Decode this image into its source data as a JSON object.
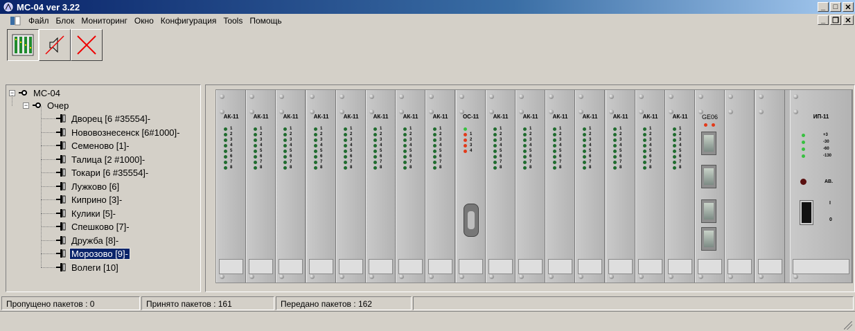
{
  "window": {
    "title": "МС-04  ver 3.22"
  },
  "menu": {
    "items": [
      "Файл",
      "Блок",
      "Мониторинг",
      "Окно",
      "Конфигурация",
      "Tools",
      "Помощь"
    ]
  },
  "toolbar": {
    "buttons": [
      {
        "icon": "rack-view-icon"
      },
      {
        "icon": "sound-off-icon"
      },
      {
        "icon": "close-x-icon"
      }
    ]
  },
  "tree": {
    "root": "МС-04",
    "group": "Очер",
    "selected_index": 10,
    "items": [
      "Дворец [6 #35554]-",
      "Нововознесенск [6#1000]-",
      "Семеново [1]-",
      "Талица [2 #1000]-",
      "Токари [6 #35554]-",
      "Лужково [6]",
      "Киприно [3]-",
      "Кулики [5]-",
      "Спешково [7]-",
      "Дружба [8]-",
      "Морозово [9]-",
      "Волеги [10]"
    ]
  },
  "rack": {
    "cards": [
      {
        "name": "АК-11",
        "kind": "ak"
      },
      {
        "name": "АК-11",
        "kind": "ak"
      },
      {
        "name": "АК-11",
        "kind": "ak"
      },
      {
        "name": "АК-11",
        "kind": "ak"
      },
      {
        "name": "АК-11",
        "kind": "ak"
      },
      {
        "name": "АК-11",
        "kind": "ak"
      },
      {
        "name": "АК-11",
        "kind": "ak"
      },
      {
        "name": "АК-11",
        "kind": "ak"
      },
      {
        "name": "ОС-11",
        "kind": "oc"
      },
      {
        "name": "АК-11",
        "kind": "ak"
      },
      {
        "name": "АК-11",
        "kind": "ak"
      },
      {
        "name": "АК-11",
        "kind": "ak"
      },
      {
        "name": "АК-11",
        "kind": "ak"
      },
      {
        "name": "АК-11",
        "kind": "ak"
      },
      {
        "name": "АК-11",
        "kind": "ak"
      },
      {
        "name": "АК-11",
        "kind": "ak"
      },
      {
        "name": "GE06",
        "kind": "ge"
      },
      {
        "name": "",
        "kind": "blank"
      },
      {
        "name": "",
        "kind": "blank"
      },
      {
        "name": "ИП-11",
        "kind": "psu"
      }
    ],
    "ak_channels": [
      "1",
      "2",
      "3",
      "4",
      "5",
      "6",
      "7",
      "8"
    ],
    "oc_channels": [
      "1",
      "2",
      "3",
      "4"
    ],
    "psu_labels": [
      "+3",
      "-30",
      "-60",
      "-130"
    ],
    "psu_alarm": "АВ.",
    "psu_switch_on": "I",
    "psu_switch_off": "0",
    "colors": {
      "led_dark_green": "#1f6b2e",
      "led_red": "#e23a1a",
      "led_bright_green": "#38c040"
    }
  },
  "status": {
    "dropped": "Пропущено пакетов : 0",
    "received": "Принято пакетов : 161",
    "sent": "Передано пакетов : 162"
  }
}
